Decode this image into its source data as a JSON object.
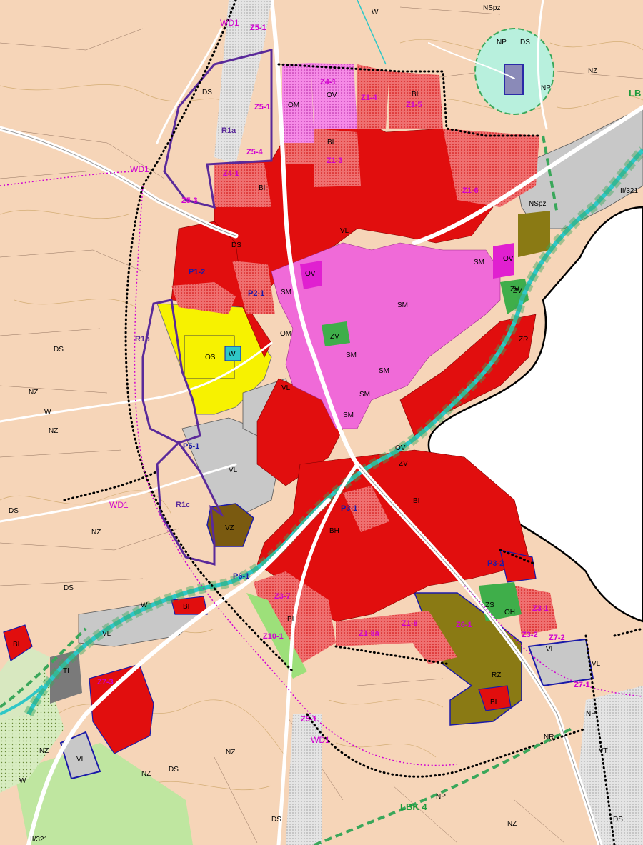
{
  "colors": {
    "background": "#f6d5b8",
    "residential": "#e10e0e",
    "mixed_center": "#f06ad8",
    "sports": "#f7f200",
    "industry": "#c8c8c8",
    "agri": "#8a7a14",
    "water": "#2fc7c7",
    "green": "#3fae4a",
    "meadow": "#dff2c8",
    "forest_empty": "#ffffff",
    "proposal_boundary": "#5a2a9a",
    "transport_corridor": "#e5e5e5"
  },
  "labels": [
    {
      "t": "WD1",
      "c": "wd"
    },
    {
      "t": "Z5-1",
      "c": "mag"
    },
    {
      "t": "W",
      "c": "lbl"
    },
    {
      "t": "NSpz",
      "c": "lbl"
    },
    {
      "t": "NP",
      "c": "lbl"
    },
    {
      "t": "DS",
      "c": "lbl"
    },
    {
      "t": "NP",
      "c": "lbl"
    },
    {
      "t": "NZ",
      "c": "lbl"
    },
    {
      "t": "LB",
      "c": "green"
    },
    {
      "t": "Z4-1",
      "c": "mag"
    },
    {
      "t": "OV",
      "c": "lbl"
    },
    {
      "t": "Z1-4",
      "c": "mag"
    },
    {
      "t": "BI",
      "c": "lbl"
    },
    {
      "t": "Z1-5",
      "c": "mag"
    },
    {
      "t": "DS",
      "c": "lbl"
    },
    {
      "t": "Z5-1",
      "c": "mag"
    },
    {
      "t": "OM",
      "c": "lbl"
    },
    {
      "t": "R1a",
      "c": "purple"
    },
    {
      "t": "Z5-4",
      "c": "mag"
    },
    {
      "t": "BI",
      "c": "lbl"
    },
    {
      "t": "Z1-3",
      "c": "mag"
    },
    {
      "t": "Z1-6",
      "c": "mag"
    },
    {
      "t": "WD1",
      "c": "wd"
    },
    {
      "t": "Z4-1",
      "c": "mag"
    },
    {
      "t": "BI",
      "c": "lbl"
    },
    {
      "t": "Z5-3",
      "c": "mag"
    },
    {
      "t": "NSpz",
      "c": "lbl"
    },
    {
      "t": "II/321",
      "c": "lbl"
    },
    {
      "t": "VL",
      "c": "lbl"
    },
    {
      "t": "DS",
      "c": "lbl"
    },
    {
      "t": "SM",
      "c": "lbl"
    },
    {
      "t": "OV",
      "c": "lbl"
    },
    {
      "t": "P1-2",
      "c": "blue"
    },
    {
      "t": "P2-1",
      "c": "blue"
    },
    {
      "t": "SM",
      "c": "lbl"
    },
    {
      "t": "SM",
      "c": "lbl"
    },
    {
      "t": "ZV",
      "c": "lbl"
    },
    {
      "t": "R1b",
      "c": "purple"
    },
    {
      "t": "OS",
      "c": "lbl"
    },
    {
      "t": "W",
      "c": "lbl"
    },
    {
      "t": "OM",
      "c": "lbl"
    },
    {
      "t": "ZV",
      "c": "lbl"
    },
    {
      "t": "SM",
      "c": "lbl"
    },
    {
      "t": "SM",
      "c": "lbl"
    },
    {
      "t": "VL",
      "c": "lbl"
    },
    {
      "t": "DS",
      "c": "lbl"
    },
    {
      "t": "NZ",
      "c": "lbl"
    },
    {
      "t": "W",
      "c": "lbl"
    },
    {
      "t": "NZ",
      "c": "lbl"
    },
    {
      "t": "P5-1",
      "c": "blue"
    },
    {
      "t": "VL",
      "c": "lbl"
    },
    {
      "t": "SM",
      "c": "lbl"
    },
    {
      "t": "SM",
      "c": "lbl"
    },
    {
      "t": "OV",
      "c": "lbl"
    },
    {
      "t": "ZV",
      "c": "lbl"
    },
    {
      "t": "WD1",
      "c": "wd"
    },
    {
      "t": "R1c",
      "c": "purple"
    },
    {
      "t": "VZ",
      "c": "lbl"
    },
    {
      "t": "P3-1",
      "c": "blue"
    },
    {
      "t": "BH",
      "c": "lbl"
    },
    {
      "t": "BI",
      "c": "lbl"
    },
    {
      "t": "DS",
      "c": "lbl"
    },
    {
      "t": "NZ",
      "c": "lbl"
    },
    {
      "t": "DS",
      "c": "lbl"
    },
    {
      "t": "P6-1",
      "c": "blue"
    },
    {
      "t": "Z3-7",
      "c": "mag"
    },
    {
      "t": "BI",
      "c": "lbl"
    },
    {
      "t": "P3-2",
      "c": "blue"
    },
    {
      "t": "OH",
      "c": "lbl"
    },
    {
      "t": "Z3-1",
      "c": "mag"
    },
    {
      "t": "ZS",
      "c": "lbl"
    },
    {
      "t": "W",
      "c": "lbl"
    },
    {
      "t": "BI",
      "c": "lbl"
    },
    {
      "t": "VL",
      "c": "lbl"
    },
    {
      "t": "Z10-1",
      "c": "mag"
    },
    {
      "t": "Z1-8a",
      "c": "mag"
    },
    {
      "t": "Z1-8",
      "c": "mag"
    },
    {
      "t": "Z6-1",
      "c": "mag"
    },
    {
      "t": "Z3-2",
      "c": "mag"
    },
    {
      "t": "Z7-2",
      "c": "mag"
    },
    {
      "t": "VL",
      "c": "lbl"
    },
    {
      "t": "TI",
      "c": "lbl"
    },
    {
      "t": "Z7-3",
      "c": "mag"
    },
    {
      "t": "RZ",
      "c": "lbl"
    },
    {
      "t": "Z7-1",
      "c": "mag"
    },
    {
      "t": "VL",
      "c": "lbl"
    },
    {
      "t": "NR",
      "c": "lbl"
    },
    {
      "t": "NP",
      "c": "lbl"
    },
    {
      "t": "BI",
      "c": "lbl"
    },
    {
      "t": "Z5-1",
      "c": "mag"
    },
    {
      "t": "WD1",
      "c": "wd"
    },
    {
      "t": "NZ",
      "c": "lbl"
    },
    {
      "t": "VL",
      "c": "lbl"
    },
    {
      "t": "NZ",
      "c": "lbl"
    },
    {
      "t": "NZ",
      "c": "lbl"
    },
    {
      "t": "DS",
      "c": "lbl"
    },
    {
      "t": "W",
      "c": "lbl"
    },
    {
      "t": "LBK 4",
      "c": "green"
    },
    {
      "t": "NP",
      "c": "lbl"
    },
    {
      "t": "DS",
      "c": "lbl"
    },
    {
      "t": "NZ",
      "c": "lbl"
    },
    {
      "t": "VT",
      "c": "lbl"
    },
    {
      "t": "II/321",
      "c": "lbl"
    },
    {
      "t": "DS",
      "c": "lbl"
    },
    {
      "t": "ZR",
      "c": "lbl"
    },
    {
      "t": "ZV",
      "c": "lbl"
    },
    {
      "t": "OV",
      "c": "lbl"
    },
    {
      "t": "BI",
      "c": "lbl"
    }
  ]
}
